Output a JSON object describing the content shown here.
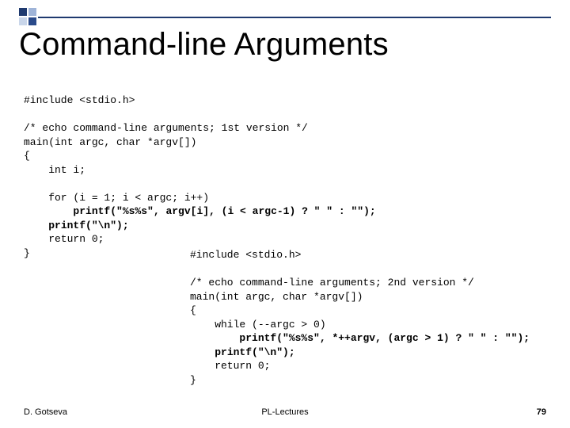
{
  "title": "Command-line Arguments",
  "code1": {
    "l1": "#include <stdio.h>",
    "l2": "",
    "l3": "/* echo command-line arguments; 1st version */",
    "l4": "main(int argc, char *argv[])",
    "l5": "{",
    "l6": "    int i;",
    "l7": "",
    "l8": "    for (i = 1; i < argc; i++)",
    "l9a": "        ",
    "l9b": "printf(\"%s%s\", argv[i], (i < argc-1) ? \" \" : \"\");",
    "l10a": "    ",
    "l10b": "printf(\"\\n\");",
    "l11": "    return 0;",
    "l12": "}"
  },
  "code2": {
    "l1": "#include <stdio.h>",
    "l2": "",
    "l3": "/* echo command-line arguments; 2nd version */",
    "l4": "main(int argc, char *argv[])",
    "l5": "{",
    "l6": "    while (--argc > 0)",
    "l7a": "        ",
    "l7b": "printf(\"%s%s\", *++argv, (argc > 1) ? \" \" : \"\");",
    "l8a": "    ",
    "l8b": "printf(\"\\n\");",
    "l9": "    return 0;",
    "l10": "}"
  },
  "footer": {
    "author": "D. Gotseva",
    "center": "PL-Lectures",
    "page": "79"
  }
}
